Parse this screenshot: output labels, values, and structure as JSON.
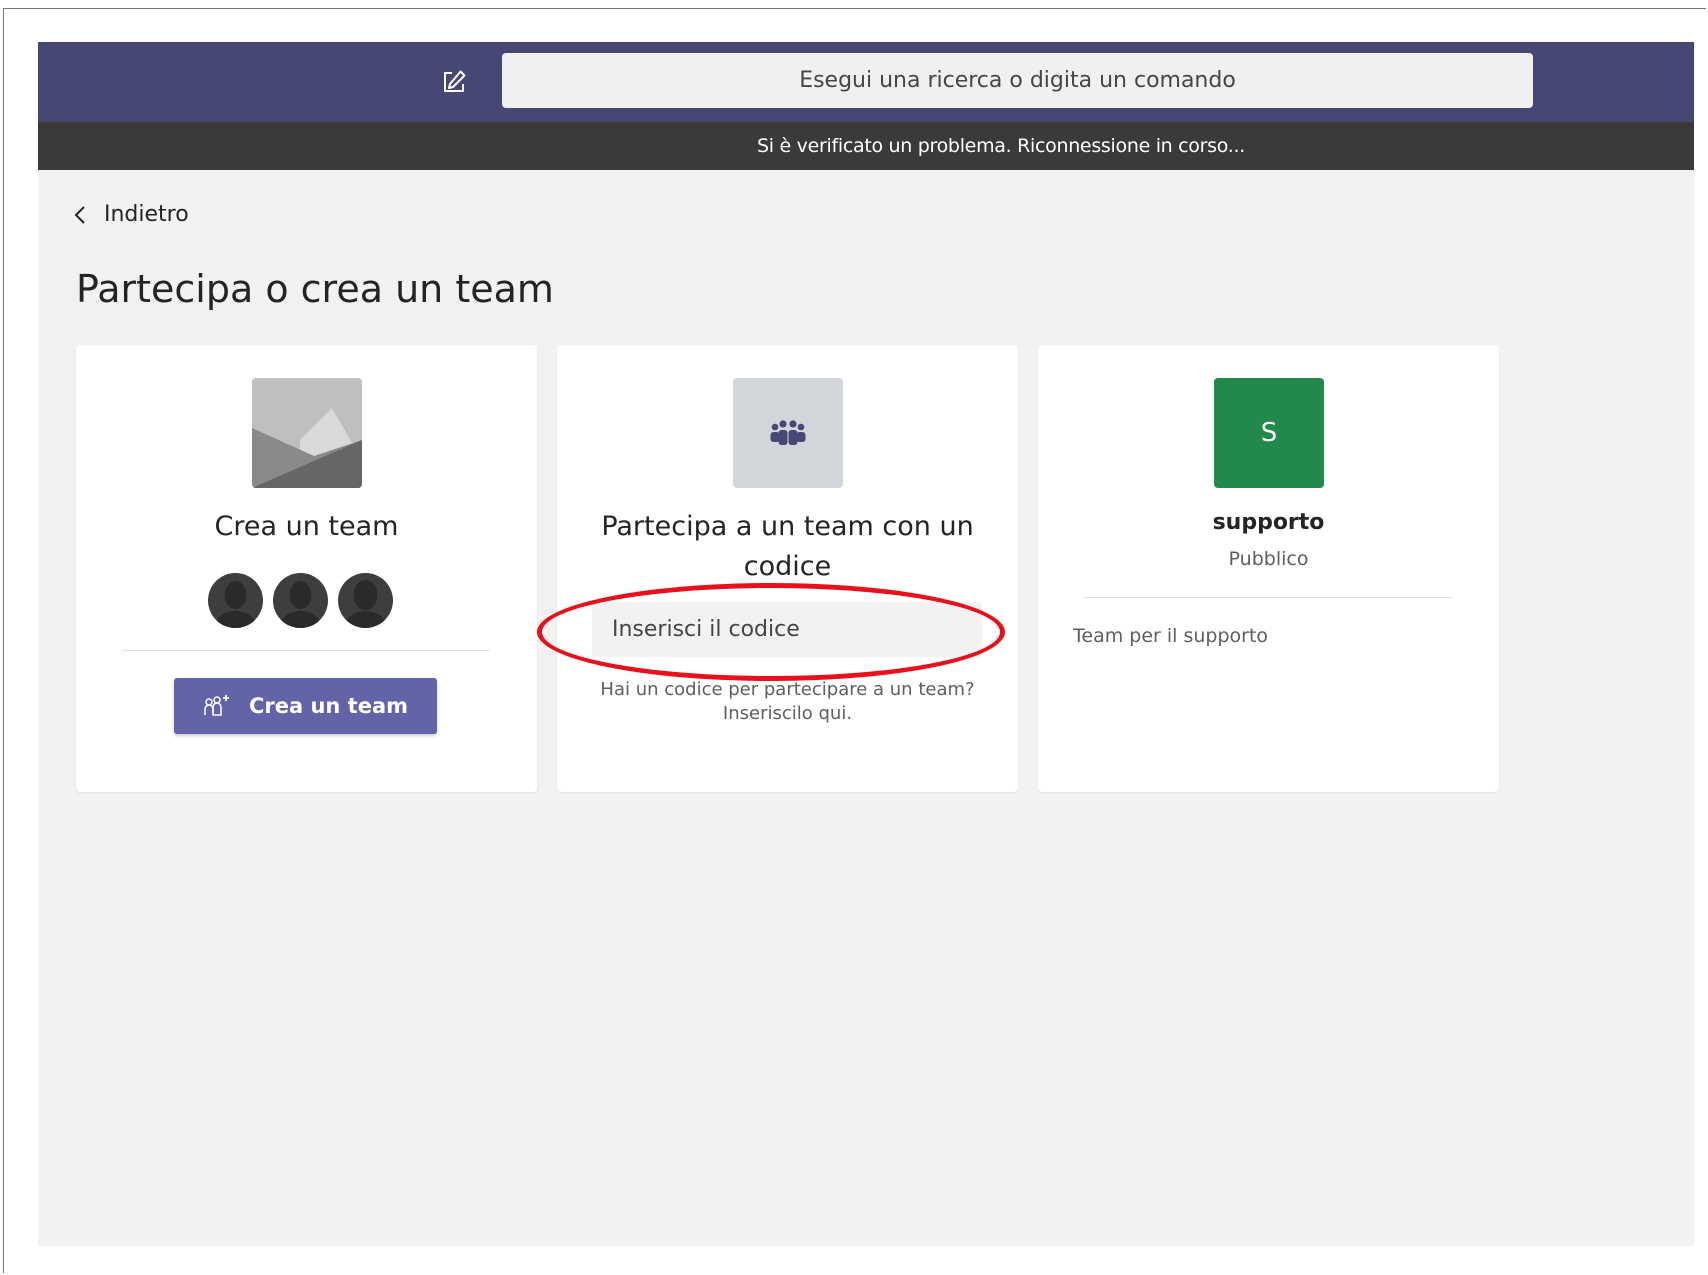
{
  "topbar": {
    "search_placeholder": "Esegui una ricerca o digita un comando",
    "compose_icon": "compose-icon"
  },
  "banner": {
    "message": "Si è verificato un problema. Riconnessione in corso..."
  },
  "nav": {
    "back_label": "Indietro"
  },
  "page": {
    "title": "Partecipa o crea un team"
  },
  "cards": {
    "create": {
      "title": "Crea un team",
      "button_label": "Crea un team"
    },
    "join": {
      "title": "Partecipa a un team con un codice",
      "code_placeholder": "Inserisci il codice",
      "hint_line1": "Hai un codice per partecipare a un team?",
      "hint_line2": "Inseriscilo qui."
    },
    "team": {
      "initial": "S",
      "name": "supporto",
      "privacy": "Pubblico",
      "description": "Team per il supporto"
    }
  },
  "colors": {
    "topbar": "#464775",
    "banner": "#3b3a39",
    "primary": "#6264a7",
    "team_avatar": "#23884b",
    "annotation": "#e8101a"
  }
}
